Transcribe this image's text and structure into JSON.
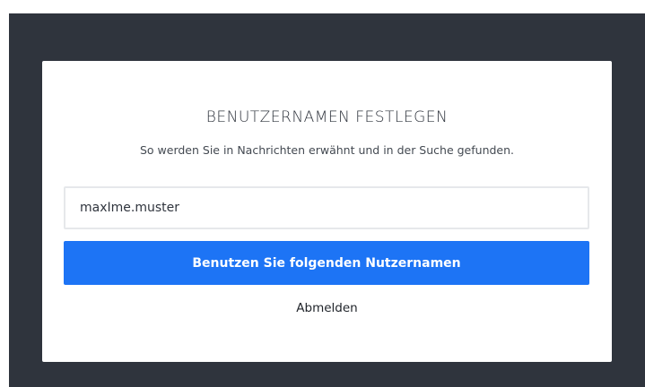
{
  "dialog": {
    "title": "BENUTZERNAMEN FESTLEGEN",
    "subtitle": "So werden Sie in Nachrichten erwähnt und in der Suche gefunden.",
    "username_value": "maxIme.muster",
    "submit_label": "Benutzen Sie folgenden Nutzernamen",
    "logout_label": "Abmelden"
  },
  "colors": {
    "backdrop": "#2f343d",
    "card": "#ffffff",
    "primary": "#1d74f5"
  }
}
